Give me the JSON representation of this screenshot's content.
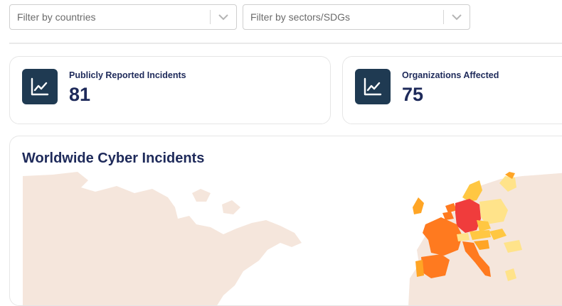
{
  "filters": {
    "countries_placeholder": "Filter by countries",
    "sectors_placeholder": "Filter by sectors/SDGs"
  },
  "stats": {
    "incidents": {
      "label": "Publicly Reported Incidents",
      "value": "81",
      "icon": "line-chart-icon"
    },
    "organizations": {
      "label": "Organizations Affected",
      "value": "75",
      "icon": "line-chart-icon"
    }
  },
  "map": {
    "title": "Worldwide Cyber Incidents",
    "colors": {
      "land": "#f5e6dc",
      "high": "#f03c3c",
      "mid_high": "#ff7a1f",
      "mid": "#ffa525",
      "low": "#ffc742",
      "lowest": "#ffe38a"
    }
  }
}
